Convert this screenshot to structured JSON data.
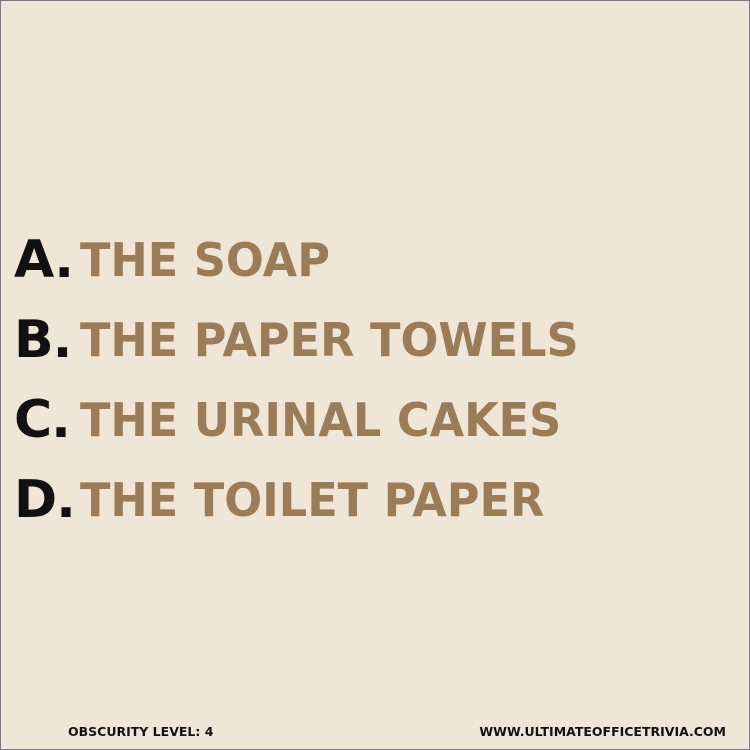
{
  "answers": [
    {
      "letter": "A.",
      "text": "THE SOAP"
    },
    {
      "letter": "B.",
      "text": "THE PAPER TOWELS"
    },
    {
      "letter": "C.",
      "text": "THE URINAL CAKES"
    },
    {
      "letter": "D.",
      "text": "THE TOILET PAPER"
    }
  ],
  "footer": {
    "obscurity": "OBSCURITY LEVEL: 4",
    "website": "WWW.ULTIMATEOFFICETRIVIA.COM"
  },
  "colors": {
    "background": "#f0e6d7",
    "letter": "#111111",
    "answer_text": "#9b7c58"
  }
}
